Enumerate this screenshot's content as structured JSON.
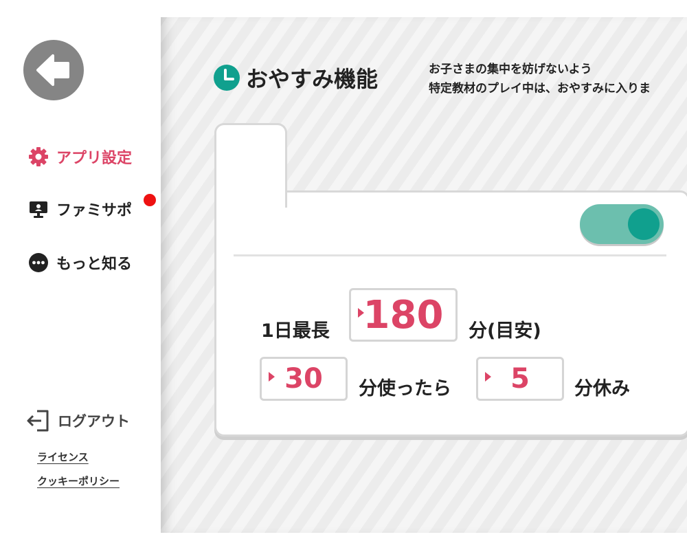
{
  "sidebar": {
    "back_icon": "arrow-left-icon",
    "items": [
      {
        "label": "アプリ設定",
        "icon": "gear-icon",
        "active": true
      },
      {
        "label": "ファミサポ",
        "icon": "monitor-icon",
        "active": false,
        "notification": true
      },
      {
        "label": "もっと知る",
        "icon": "more-icon",
        "active": false
      }
    ],
    "logout": {
      "label": "ログアウト",
      "icon": "logout-icon"
    },
    "links": {
      "license": "ライセンス",
      "cookie_policy": "クッキーポリシー"
    }
  },
  "main": {
    "title": "おやすみ機能",
    "title_icon": "clock-icon",
    "description_line1": "お子さまの集中を妨げないよう",
    "description_line2": "特定教材のプレイ中は、おやすみに入りま",
    "toggle_on": true,
    "daily_max_label": "1日最長",
    "daily_max_value": "180",
    "daily_max_unit": "分(目安)",
    "play_value": "30",
    "play_label": "分使ったら",
    "rest_value": "5",
    "rest_label": "分休み"
  },
  "colors": {
    "accent": "#dc4466",
    "teal": "#10a08e",
    "toggle_track": "#6cbfae",
    "back_button": "#858585",
    "notification": "#ee1111"
  }
}
